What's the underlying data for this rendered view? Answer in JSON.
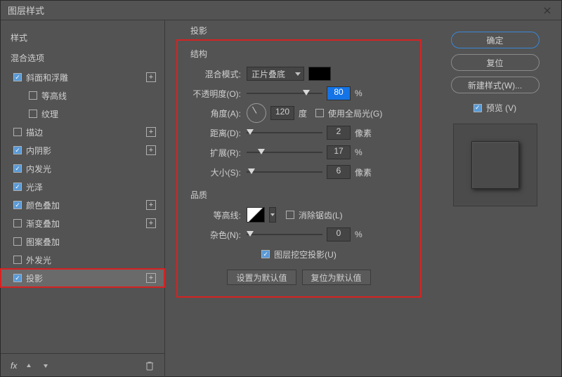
{
  "window": {
    "title": "图层样式"
  },
  "sidebar": {
    "header": "样式",
    "sub_header": "混合选项",
    "items": [
      {
        "label": "斜面和浮雕",
        "checked": true,
        "plus": true
      },
      {
        "label": "等高线",
        "checked": false,
        "sub": true
      },
      {
        "label": "纹理",
        "checked": false,
        "sub": true
      },
      {
        "label": "描边",
        "checked": false,
        "plus": true
      },
      {
        "label": "内阴影",
        "checked": true,
        "plus": true
      },
      {
        "label": "内发光",
        "checked": true
      },
      {
        "label": "光泽",
        "checked": true
      },
      {
        "label": "颜色叠加",
        "checked": true,
        "plus": true
      },
      {
        "label": "渐变叠加",
        "checked": false,
        "plus": true
      },
      {
        "label": "图案叠加",
        "checked": false
      },
      {
        "label": "外发光",
        "checked": false
      },
      {
        "label": "投影",
        "checked": true,
        "plus": true,
        "selected": true
      }
    ],
    "footer_fx": "fx"
  },
  "settings": {
    "title": "投影",
    "structure_label": "结构",
    "blend_mode_label": "混合模式:",
    "blend_mode_value": "正片叠底",
    "opacity_label": "不透明度(O):",
    "opacity_value": "80",
    "opacity_unit": "%",
    "angle_label": "角度(A):",
    "angle_value": "120",
    "angle_unit": "度",
    "global_light_label": "使用全局光(G)",
    "distance_label": "距离(D):",
    "distance_value": "2",
    "distance_unit": "像素",
    "spread_label": "扩展(R):",
    "spread_value": "17",
    "spread_unit": "%",
    "size_label": "大小(S):",
    "size_value": "6",
    "size_unit": "像素",
    "quality_label": "品质",
    "contour_label": "等高线:",
    "antialias_label": "消除锯齿(L)",
    "noise_label": "杂色(N):",
    "noise_value": "0",
    "noise_unit": "%",
    "knockout_label": "图层挖空投影(U)",
    "set_default": "设置为默认值",
    "reset_default": "复位为默认值"
  },
  "actions": {
    "ok": "确定",
    "reset": "复位",
    "new_style": "新建样式(W)...",
    "preview": "预览 (V)"
  }
}
